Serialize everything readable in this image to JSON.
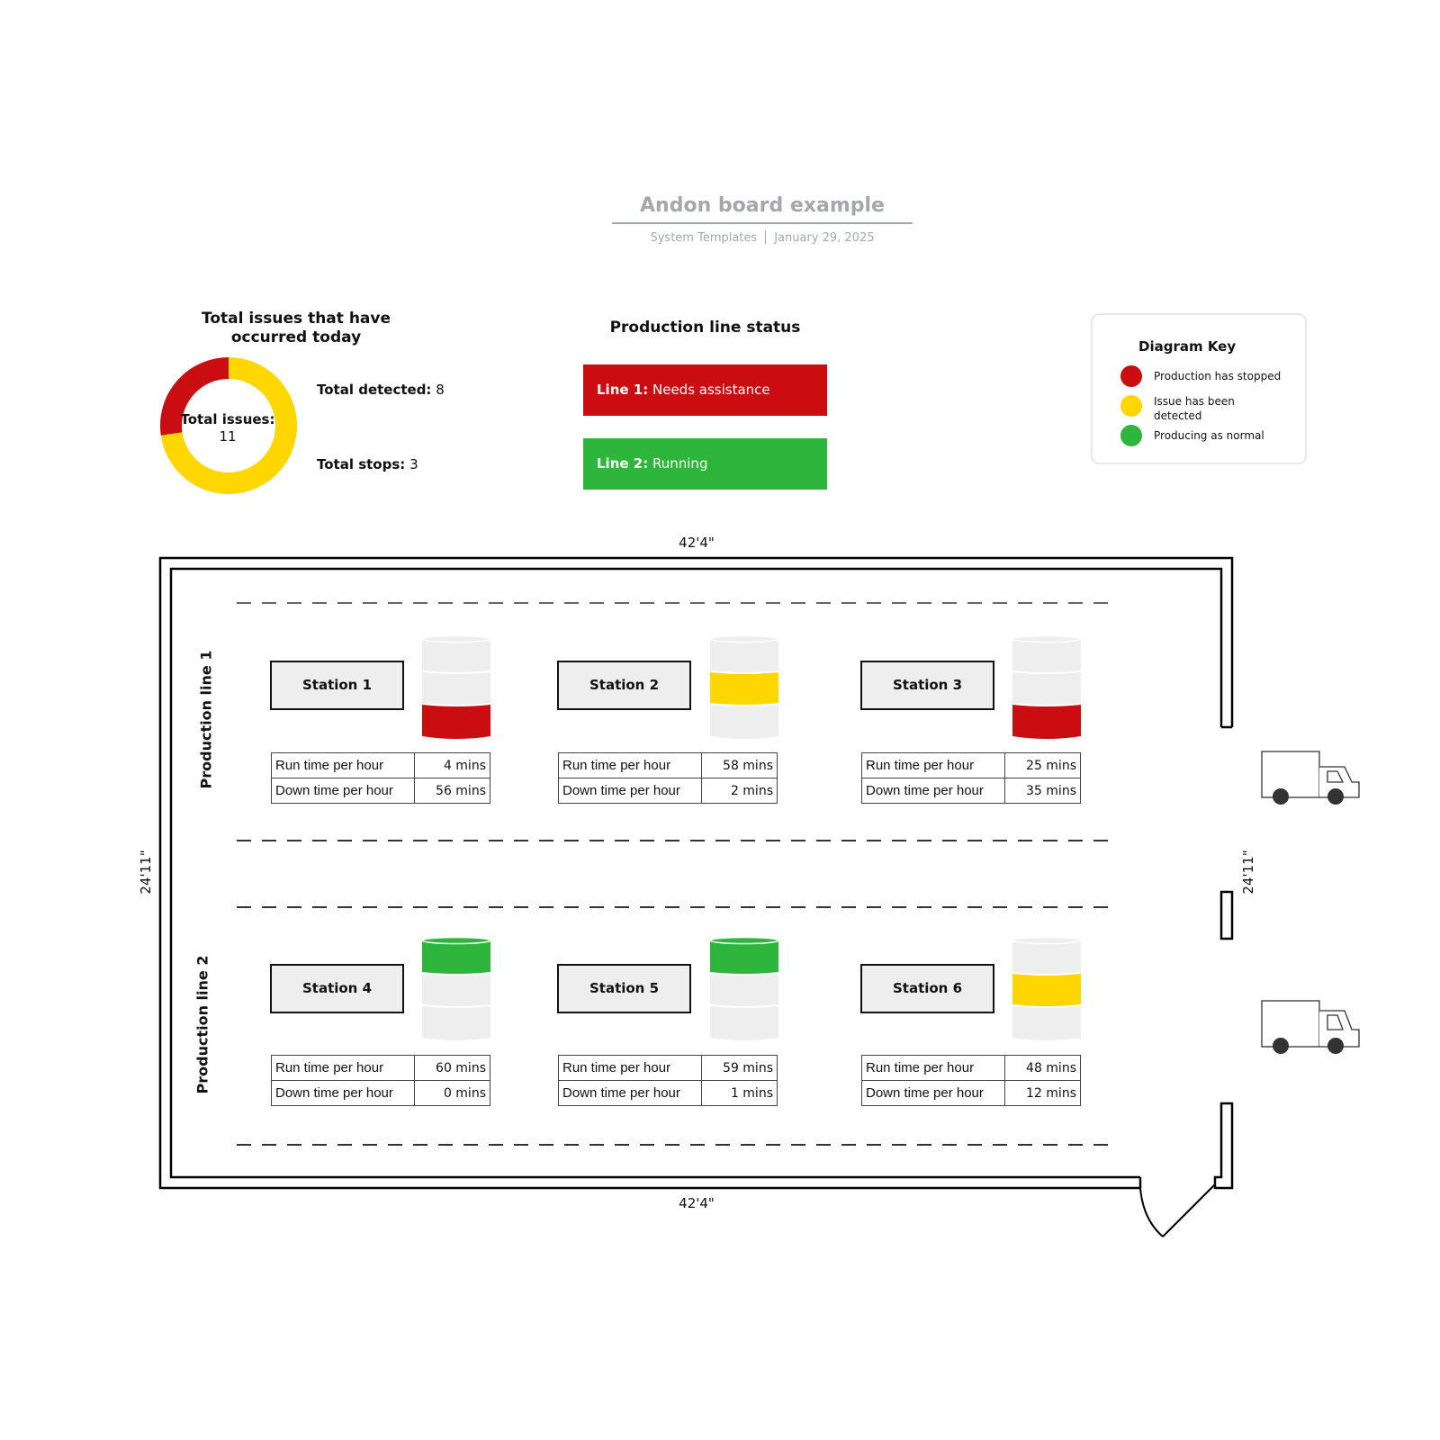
{
  "header": {
    "title": "Andon board example",
    "source": "System Templates",
    "date": "January 29, 2025"
  },
  "colors": {
    "stopped": "#c90d10",
    "detected": "#ffd600",
    "normal": "#2eb53b",
    "idle": "#eeeeee"
  },
  "issues": {
    "title": "Total issues that have occurred today",
    "total_label": "Total issues:",
    "total_value": "11",
    "detected_label": "Total detected:",
    "detected_value": "8",
    "stops_label": "Total stops:",
    "stops_value": "3",
    "chart_data": {
      "type": "pie",
      "title": "Total issues that have occurred today",
      "categories": [
        "Total stops",
        "Total detected"
      ],
      "values": [
        3,
        8
      ],
      "colors": [
        "#c90d10",
        "#ffd600"
      ]
    }
  },
  "status": {
    "title": "Production line status",
    "lines": [
      {
        "label": "Line 1:",
        "value": "Needs assistance",
        "state": "stopped"
      },
      {
        "label": "Line 2:",
        "value": "Running",
        "state": "normal"
      }
    ]
  },
  "key": {
    "title": "Diagram Key",
    "items": [
      {
        "label": "Production has stopped",
        "state": "stopped"
      },
      {
        "label": "Issue has been detected",
        "state": "detected"
      },
      {
        "label": "Producing as normal",
        "state": "normal"
      }
    ]
  },
  "floor": {
    "width_top": "42'4\"",
    "width_bottom": "42'4\"",
    "height_left": "24'11\"",
    "height_right": "24'11\"",
    "lines": [
      {
        "label": "Production line 1"
      },
      {
        "label": "Production line 2"
      }
    ],
    "run_label": "Run time per hour",
    "down_label": "Down time per hour",
    "stations": [
      {
        "name": "Station 1",
        "run": "4 mins",
        "down": "56 mins",
        "light": "stopped",
        "lit_segment": "bottom"
      },
      {
        "name": "Station 2",
        "run": "58 mins",
        "down": "2 mins",
        "light": "detected",
        "lit_segment": "middle"
      },
      {
        "name": "Station 3",
        "run": "25 mins",
        "down": "35 mins",
        "light": "stopped",
        "lit_segment": "bottom"
      },
      {
        "name": "Station 4",
        "run": "60 mins",
        "down": "0 mins",
        "light": "normal",
        "lit_segment": "top"
      },
      {
        "name": "Station 5",
        "run": "59 mins",
        "down": "1 mins",
        "light": "normal",
        "lit_segment": "top"
      },
      {
        "name": "Station 6",
        "run": "48 mins",
        "down": "12 mins",
        "light": "detected",
        "lit_segment": "middle"
      }
    ]
  }
}
